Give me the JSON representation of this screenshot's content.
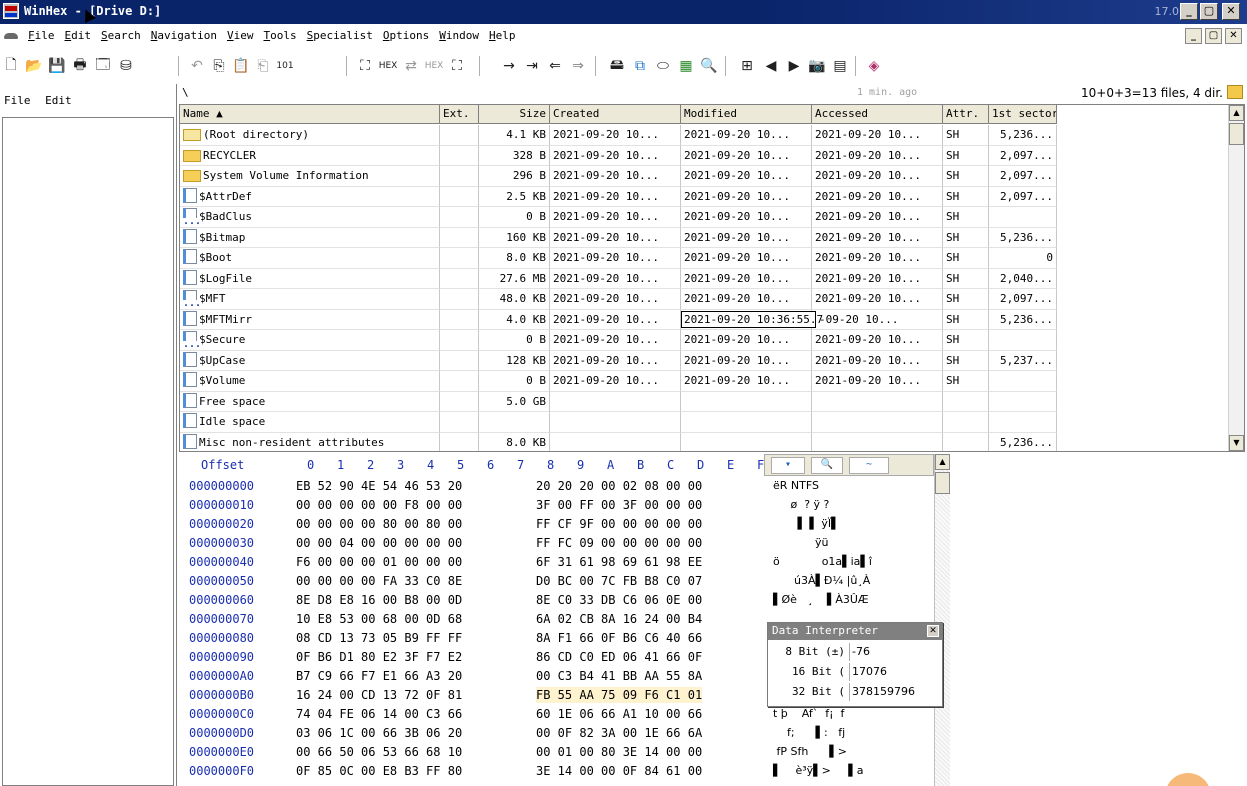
{
  "titlebar": {
    "title": "WinHex - [Drive D:]",
    "version": "17.0",
    "min": "_",
    "max": "▢",
    "close": "✕"
  },
  "menubar": {
    "items": [
      "File",
      "Edit",
      "Search",
      "Navigation",
      "View",
      "Tools",
      "Specialist",
      "Options",
      "Window",
      "Help"
    ]
  },
  "leftpanel": {
    "menu_file": "File",
    "menu_edit": "Edit"
  },
  "dirpanel": {
    "path": "\\",
    "ago": "1 min. ago",
    "count": "10+0+3=13 files, 4 dir.",
    "columns": [
      "Name ▲",
      "Ext.",
      "Size",
      "Created",
      "Modified",
      "Accessed",
      "Attr.",
      "1st sector"
    ],
    "rows": [
      {
        "icon": "root",
        "name": "(Root directory)",
        "ext": "",
        "size": "4.1 KB",
        "created": "2021-09-20  10...",
        "modified": "2021-09-20  10...",
        "accessed": "2021-09-20  10...",
        "attr": "SH",
        "sector": "5,236..."
      },
      {
        "icon": "folder",
        "name": "RECYCLER",
        "ext": "",
        "size": "328 B",
        "created": "2021-09-20  10...",
        "modified": "2021-09-20  10...",
        "accessed": "2021-09-20  10...",
        "attr": "SH",
        "sector": "2,097..."
      },
      {
        "icon": "folder",
        "name": "System Volume Information",
        "ext": "",
        "size": "296 B",
        "created": "2021-09-20  10...",
        "modified": "2021-09-20  10...",
        "accessed": "2021-09-20  10...",
        "attr": "SH",
        "sector": "2,097..."
      },
      {
        "icon": "file",
        "name": "$AttrDef",
        "ext": "",
        "size": "2.5 KB",
        "created": "2021-09-20  10...",
        "modified": "2021-09-20  10...",
        "accessed": "2021-09-20  10...",
        "attr": "SH",
        "sector": "2,097..."
      },
      {
        "icon": "blue",
        "name": "$BadClus",
        "ext": "",
        "size": "0 B",
        "created": "2021-09-20  10...",
        "modified": "2021-09-20  10...",
        "accessed": "2021-09-20  10...",
        "attr": "SH",
        "sector": ""
      },
      {
        "icon": "file",
        "name": "$Bitmap",
        "ext": "",
        "size": "160 KB",
        "created": "2021-09-20  10...",
        "modified": "2021-09-20  10...",
        "accessed": "2021-09-20  10...",
        "attr": "SH",
        "sector": "5,236..."
      },
      {
        "icon": "file",
        "name": "$Boot",
        "ext": "",
        "size": "8.0 KB",
        "created": "2021-09-20  10...",
        "modified": "2021-09-20  10...",
        "accessed": "2021-09-20  10...",
        "attr": "SH",
        "sector": "0"
      },
      {
        "icon": "file",
        "name": "$LogFile",
        "ext": "",
        "size": "27.6 MB",
        "created": "2021-09-20  10...",
        "modified": "2021-09-20  10...",
        "accessed": "2021-09-20  10...",
        "attr": "SH",
        "sector": "2,040..."
      },
      {
        "icon": "blue",
        "name": "$MFT",
        "ext": "",
        "size": "48.0 KB",
        "created": "2021-09-20  10...",
        "modified": "2021-09-20  10...",
        "accessed": "2021-09-20  10...",
        "attr": "SH",
        "sector": "2,097..."
      },
      {
        "icon": "file",
        "name": "$MFTMirr",
        "ext": "",
        "size": "4.0 KB",
        "created": "2021-09-20  10...",
        "modified": "2021-09-20  10:36:55.7",
        "accessed": "-09-20  10...",
        "attr": "SH",
        "sector": "5,236..."
      },
      {
        "icon": "blue",
        "name": "$Secure",
        "ext": "",
        "size": "0 B",
        "created": "2021-09-20  10...",
        "modified": "2021-09-20  10...",
        "accessed": "2021-09-20  10...",
        "attr": "SH",
        "sector": ""
      },
      {
        "icon": "file",
        "name": "$UpCase",
        "ext": "",
        "size": "128 KB",
        "created": "2021-09-20  10...",
        "modified": "2021-09-20  10...",
        "accessed": "2021-09-20  10...",
        "attr": "SH",
        "sector": "5,237..."
      },
      {
        "icon": "file",
        "name": "$Volume",
        "ext": "",
        "size": "0 B",
        "created": "2021-09-20  10...",
        "modified": "2021-09-20  10...",
        "accessed": "2021-09-20  10...",
        "attr": "SH",
        "sector": ""
      },
      {
        "icon": "file",
        "name": "Free space",
        "ext": "",
        "size": "5.0 GB",
        "created": "",
        "modified": "",
        "accessed": "",
        "attr": "",
        "sector": ""
      },
      {
        "icon": "file",
        "name": "Idle space",
        "ext": "",
        "size": "",
        "created": "",
        "modified": "",
        "accessed": "",
        "attr": "",
        "sector": ""
      },
      {
        "icon": "file",
        "name": "Misc non-resident attributes",
        "ext": "",
        "size": "8.0 KB",
        "created": "",
        "modified": "",
        "accessed": "",
        "attr": "",
        "sector": "5,236..."
      }
    ]
  },
  "hex": {
    "header_offset": "Offset",
    "header_cols": [
      "0",
      "1",
      "2",
      "3",
      "4",
      "5",
      "6",
      "7",
      "8",
      "9",
      "A",
      "B",
      "C",
      "D",
      "E",
      "F"
    ],
    "rows": [
      {
        "off": "000000000",
        "b1": "EB 52 90 4E 54 46 53 20",
        "b2": "20 20 20 00 02 08 00 00",
        "txt": "ëR NTFS"
      },
      {
        "off": "000000010",
        "b1": "00 00 00 00 00 F8 00 00",
        "b2": "3F 00 FF 00 3F 00 00 00",
        "txt": "     ø  ? ÿ ?"
      },
      {
        "off": "000000020",
        "b1": "00 00 00 00 80 00 80 00",
        "b2": "FF CF 9F 00 00 00 00 00",
        "txt": "       ▌ ▌ ÿÏ▌"
      },
      {
        "off": "000000030",
        "b1": "00 00 04 00 00 00 00 00",
        "b2": "FF FC 09 00 00 00 00 00",
        "txt": "            ÿü"
      },
      {
        "off": "000000040",
        "b1": "F6 00 00 00 01 00 00 00",
        "b2": "6F 31 61 98 69 61 98 EE",
        "txt": "ö            o1a▌ia▌î"
      },
      {
        "off": "000000050",
        "b1": "00 00 00 00 FA 33 C0 8E",
        "b2": "D0 BC 00 7C FB B8 C0 07",
        "txt": "      ú3À▌Ð¼ |û¸À"
      },
      {
        "off": "000000060",
        "b1": "8E D8 E8 16 00 B8 00 0D",
        "b2": "8E C0 33 DB C6 06 0E 00",
        "txt": "▌Øè   ¸    ▌À3ÛÆ"
      },
      {
        "off": "000000070",
        "b1": "10 E8 53 00 68 00 0D 68",
        "b2": "6A 02 CB 8A 16 24 00 B4",
        "txt": ""
      },
      {
        "off": "000000080",
        "b1": "08 CD 13 73 05 B9 FF FF",
        "b2": "8A F1 66 0F B6 C6 40 66",
        "txt": ""
      },
      {
        "off": "000000090",
        "b1": "0F B6 D1 80 E2 3F F7 E2",
        "b2": "86 CD C0 ED 06 41 66 0F",
        "txt": ""
      },
      {
        "off": "0000000A0",
        "b1": "B7 C9 66 F7 E1 66 A3 20",
        "b2": "00 C3 B4 41 BB AA 55 8A",
        "txt": ""
      },
      {
        "off": "0000000B0",
        "b1": "16 24 00 CD 13 72 0F 81",
        "b2": "FB 55 AA 75 09 F6 C1 01",
        "txt": ""
      },
      {
        "off": "0000000C0",
        "b1": "74 04 FE 06 14 00 C3 66",
        "b2": "60 1E 06 66 A1 10 00 66",
        "txt": "t þ    Ãf`  f¡  f"
      },
      {
        "off": "0000000D0",
        "b1": "03 06 1C 00 66 3B 06 20",
        "b2": "00 0F 82 3A 00 1E 66 6A",
        "txt": "    f;      ▌:   fj"
      },
      {
        "off": "0000000E0",
        "b1": "00 66 50 06 53 66 68 10",
        "b2": "00 01 00 80 3E 14 00 00",
        "txt": " fP Sfh      ▌>"
      },
      {
        "off": "0000000F0",
        "b1": "0F 85 0C 00 E8 B3 FF 80",
        "b2": "3E 14 00 00 0F 84 61 00",
        "txt": "▌    è³ÿ▌>     ▌a"
      }
    ]
  },
  "interpreter": {
    "title": "Data Interpreter",
    "rows": [
      {
        "label": "8 Bit (±)",
        "value": "-76"
      },
      {
        "label": "16 Bit (",
        "value": "17076"
      },
      {
        "label": "32 Bit (",
        "value": "378159796"
      }
    ]
  }
}
